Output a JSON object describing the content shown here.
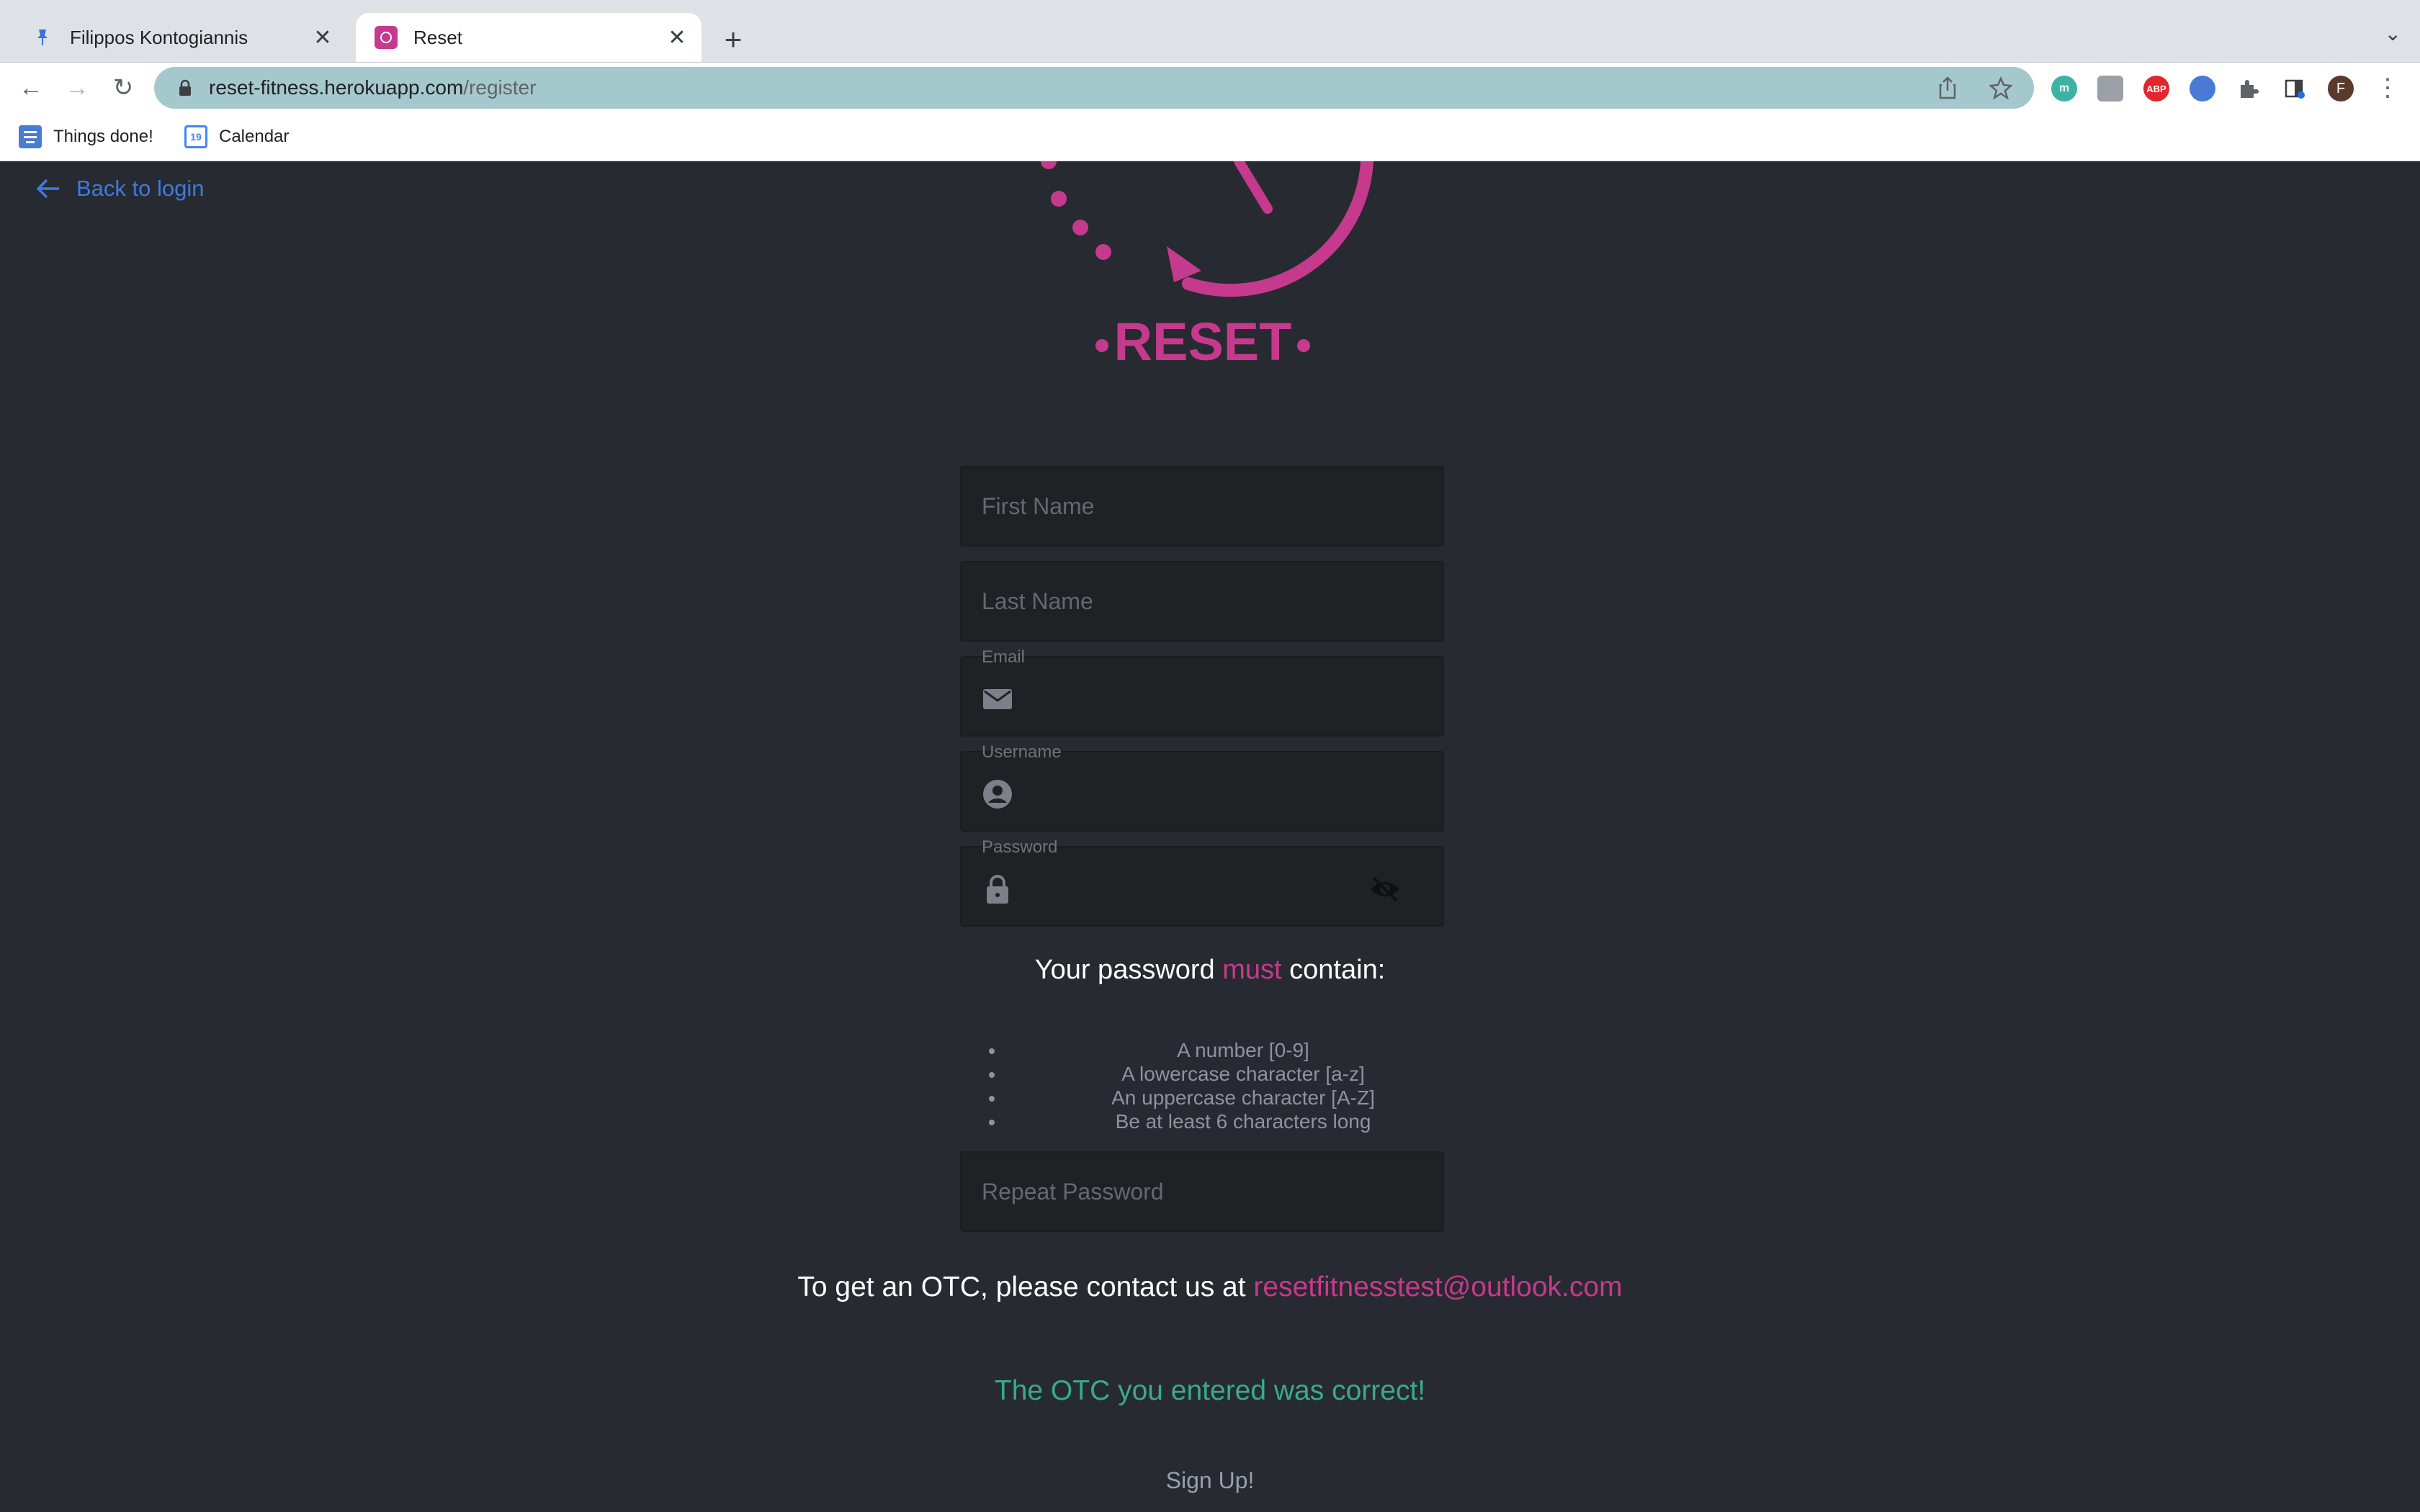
{
  "browser": {
    "tabs": [
      {
        "title": "Filippos Kontogiannis",
        "active": false
      },
      {
        "title": "Reset",
        "active": true
      }
    ],
    "url_host": "reset-fitness.herokuapp.com",
    "url_path": "/register",
    "bookmarks": [
      {
        "label": "Things done!",
        "icon": "docs-icon"
      },
      {
        "label": "Calendar",
        "icon": "calendar-icon"
      }
    ],
    "calendar_icon_text": "19",
    "profile_initial": "F",
    "extension_badge_abp": "ABP",
    "extension_badge_m": "m"
  },
  "page": {
    "back_label": "Back to login",
    "logo_text": "RESET",
    "first_name_placeholder": "First Name",
    "last_name_placeholder": "Last Name",
    "email_label": "Email",
    "username_label": "Username",
    "password_label": "Password",
    "password_rules_intro": "Your password",
    "password_rules_must": "must",
    "password_rules_end": "contain:",
    "password_rules": [
      "A number [0-9]",
      "A lowercase character [a-z]",
      "An uppercase character [A-Z]",
      "Be at least 6 characters long"
    ],
    "repeat_password_placeholder": "Repeat Password",
    "otc_text": "To get an OTC, please contact us at",
    "otc_email": "resetfitnesstest@outlook.com",
    "otc_status": "The OTC you entered was correct!",
    "signup_label": "Sign Up!"
  },
  "colors": {
    "accent_pink": "#c63a8d",
    "success_green": "#3aab86",
    "link_blue": "#3d7be0",
    "background": "#272a31"
  }
}
